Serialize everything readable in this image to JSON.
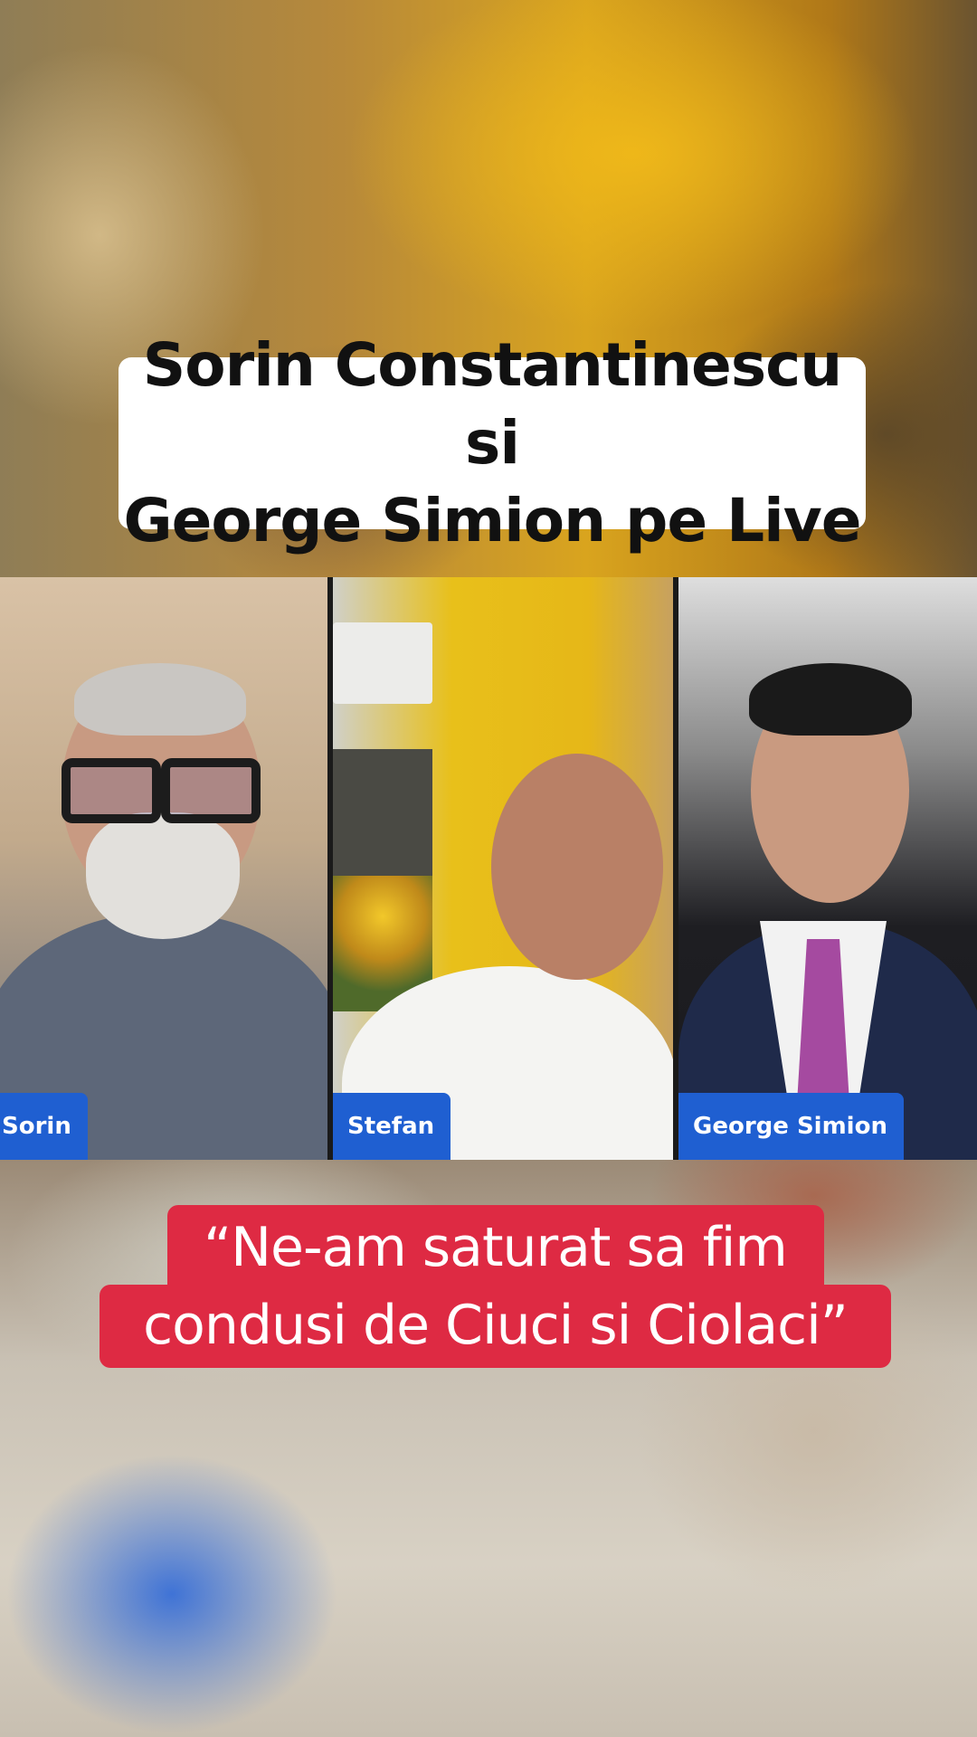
{
  "title": "Sorin Constantinescu si\nGeorge Simion pe Live",
  "participants": [
    {
      "name": "Sorin"
    },
    {
      "name": "Stefan"
    },
    {
      "name": "George Simion"
    }
  ],
  "quote": "“Ne-am saturat sa fim\ncondusi de Ciuci si Ciolaci”",
  "colors": {
    "title_bg": "#ffffff",
    "name_tag_bg": "#1f5fd1",
    "quote_bg": "#de2a43"
  }
}
